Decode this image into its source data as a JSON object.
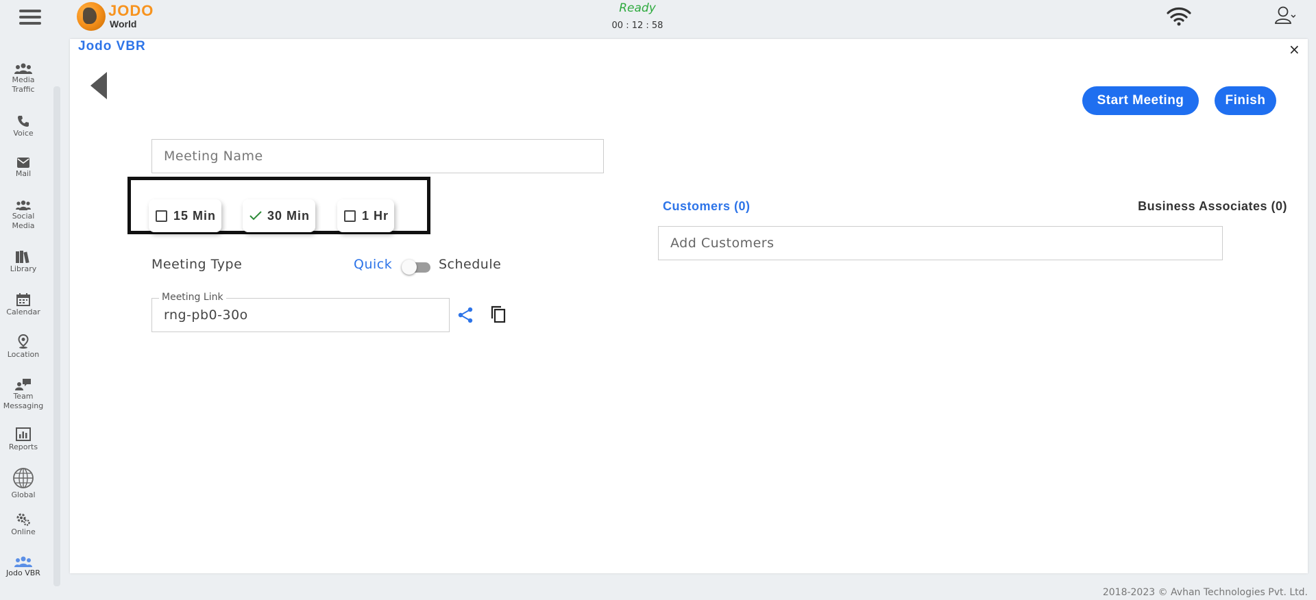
{
  "header": {
    "logo_main": "JODO",
    "logo_sub": "World",
    "status": "Ready",
    "timer": "00 : 12 : 58"
  },
  "sidebar": {
    "items": [
      {
        "label": "Media Traffic",
        "icon": "people-group-icon"
      },
      {
        "label": "Voice",
        "icon": "phone-icon"
      },
      {
        "label": "Mail",
        "icon": "envelope-icon"
      },
      {
        "label": "Social Media",
        "icon": "users-icon"
      },
      {
        "label": "Library",
        "icon": "books-icon"
      },
      {
        "label": "Calendar",
        "icon": "calendar-icon"
      },
      {
        "label": "Location",
        "icon": "location-pin-icon"
      },
      {
        "label": "Team Messaging",
        "icon": "chat-users-icon"
      },
      {
        "label": "Reports",
        "icon": "report-chart-icon"
      },
      {
        "label": "Global",
        "icon": "globe-icon"
      },
      {
        "label": "Online",
        "icon": "gears-icon"
      },
      {
        "label": "Jodo VBR",
        "icon": "people-group-icon"
      }
    ]
  },
  "panel": {
    "title": "Jodo VBR",
    "close": "×",
    "start_meeting": "Start Meeting",
    "finish": "Finish",
    "meeting_name_placeholder": "Meeting Name",
    "durations": [
      {
        "label": "15 Min",
        "checked": false
      },
      {
        "label": "30 Min",
        "checked": true
      },
      {
        "label": "1 Hr",
        "checked": false
      }
    ],
    "meeting_type_label": "Meeting Type",
    "quick_label": "Quick",
    "schedule_label": "Schedule",
    "meeting_link_label": "Meeting Link",
    "meeting_link_value": "rng-pb0-30o",
    "customers_tab": "Customers (0)",
    "associates_tab": "Business Associates (0)",
    "add_customers_placeholder": "Add Customers"
  },
  "colors": {
    "accent": "#1f6ff0",
    "link": "#2d74e8",
    "status_ready": "#2eaa3e",
    "brand_orange": "#f7931e"
  },
  "footer": {
    "copyright": "2018-2023 © Avhan Technologies Pvt. Ltd."
  }
}
